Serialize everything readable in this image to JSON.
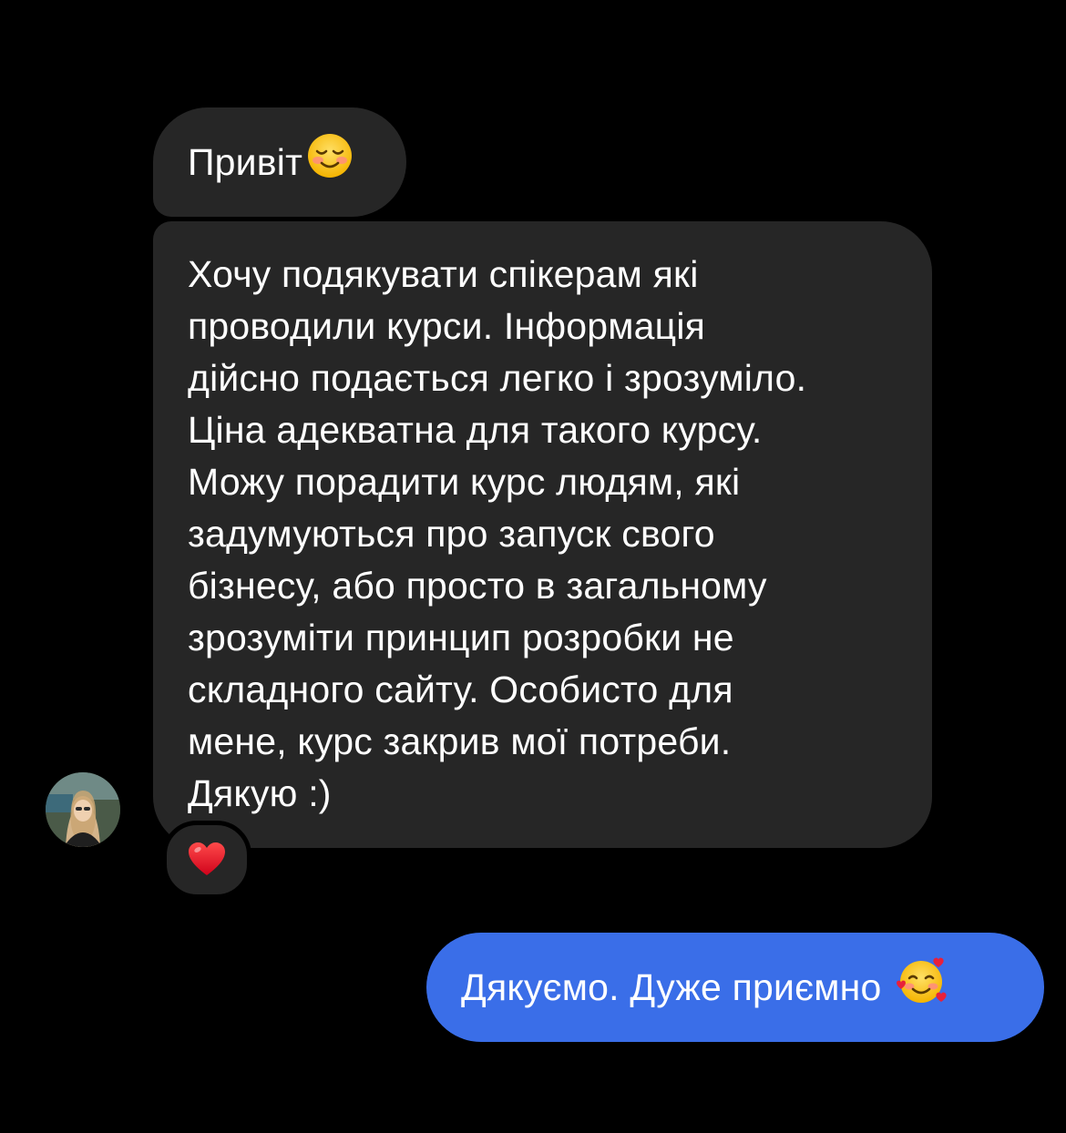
{
  "messages": [
    {
      "direction": "incoming",
      "text": "Привіт",
      "emoji": "smiling-face-emoji"
    },
    {
      "direction": "incoming",
      "lines": [
        "Хочу подякувати спікерам які",
        "проводили курси. Інформація",
        "дійсно подається легко і зрозуміло.",
        "Ціна адекватна для такого курсу.",
        "Можу порадити курс людям, які",
        "задумуються про запуск свого",
        "бізнесу, або просто в загальному",
        "зрозуміти принцип розробки не",
        "складного сайту. Особисто для",
        "мене, курс закрив мої потреби.",
        "Дякую :)"
      ],
      "reaction": "red-heart-emoji"
    },
    {
      "direction": "outgoing",
      "text": "Дякуємо. Дуже приємно",
      "emoji": "smiling-face-with-hearts-emoji"
    }
  ],
  "colors": {
    "background": "#000000",
    "incoming_bubble": "#262626",
    "outgoing_bubble": "#3a6ee8",
    "text": "#ffffff"
  },
  "icons": {
    "avatar": "user-avatar",
    "reaction": "red-heart-emoji"
  }
}
